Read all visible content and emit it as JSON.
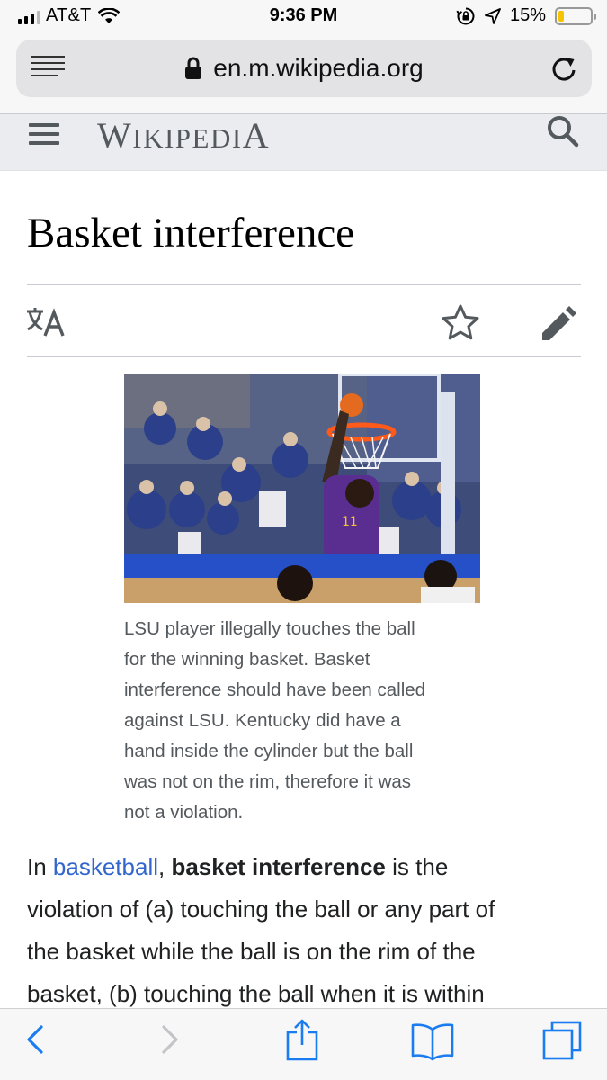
{
  "status_bar": {
    "carrier": "AT&T",
    "time": "9:36 PM",
    "battery": "15%",
    "battery_level": 0.15,
    "icons": [
      "signal-icon",
      "wifi-icon",
      "orientation-lock-icon",
      "location-icon",
      "battery-icon"
    ]
  },
  "browser": {
    "url": "en.m.wikipedia.org",
    "icons": [
      "reader-view-icon",
      "lock-icon",
      "reload-icon"
    ]
  },
  "wiki_header": {
    "wordmark_parts": [
      "W",
      "IKIPEDI",
      "A"
    ],
    "icons": [
      "menu-icon",
      "search-icon"
    ]
  },
  "article": {
    "title": "Basket interference",
    "actions": [
      "language-icon",
      "watch-star-icon",
      "edit-pencil-icon"
    ],
    "figure": {
      "image_alt": "LSU player dunking during a basketball game",
      "caption_lines": [
        "LSU player illegally touches the ball",
        "for the winning basket. Basket",
        "interference should have been called",
        "against LSU. Kentucky did have a",
        "hand inside the cylinder but the ball",
        "was not on the rim, therefore it was",
        "not a violation."
      ]
    },
    "body": {
      "line1_prefix": "In ",
      "line1_link": "basketball",
      "line1_comma": ", ",
      "line1_bold": "basket interference",
      "line1_suffix": " is the",
      "line2": "violation of (a) touching the ball or any part of",
      "line3": "the basket while the ball is on the rim of the",
      "line4": "basket, (b) touching the ball when it is within"
    }
  },
  "toolbar": {
    "icons": [
      "back-icon",
      "forward-icon",
      "share-icon",
      "bookmarks-icon",
      "tabs-icon"
    ]
  },
  "colors": {
    "link": "#3366cc",
    "header_bg": "#eaecf0",
    "toolbar_tint": "#1a7cf0",
    "battery_fill": "#f5c400"
  }
}
